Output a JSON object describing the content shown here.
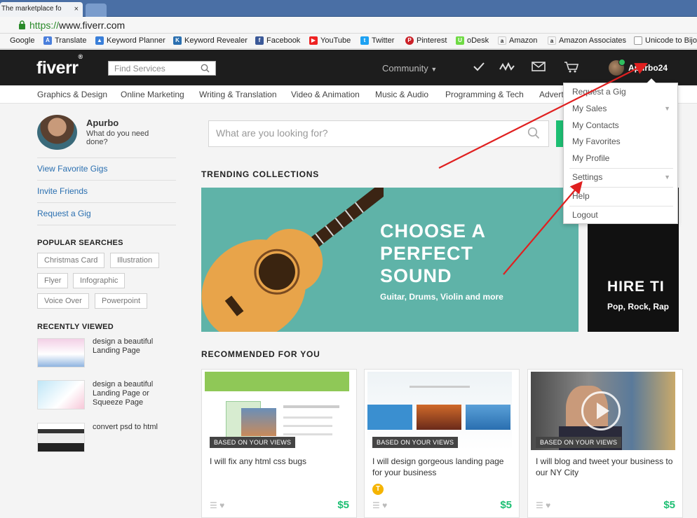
{
  "browser": {
    "tab_title": "The marketplace fo",
    "tab_close": "×",
    "url_scheme": "https://",
    "url_host": "www.fiverr.com",
    "bookmarks": [
      {
        "label": "Google",
        "icon": "google-icon"
      },
      {
        "label": "Translate",
        "icon": "translate-icon"
      },
      {
        "label": "Keyword Planner",
        "icon": "adwords-icon"
      },
      {
        "label": "Keyword Revealer",
        "icon": "keyword-revealer-icon"
      },
      {
        "label": "Facebook",
        "icon": "facebook-icon"
      },
      {
        "label": "YouTube",
        "icon": "youtube-icon"
      },
      {
        "label": "Twitter",
        "icon": "twitter-icon"
      },
      {
        "label": "Pinterest",
        "icon": "pinterest-icon"
      },
      {
        "label": "oDesk",
        "icon": "odesk-icon"
      },
      {
        "label": "Amazon",
        "icon": "amazon-icon"
      },
      {
        "label": "Amazon Associates",
        "icon": "amazon-icon"
      },
      {
        "label": "Unicode to Bijo",
        "icon": "page-icon"
      }
    ]
  },
  "header": {
    "logo": "fiverr",
    "logo_mark": "®",
    "search_placeholder": "Find Services",
    "community_label": "Community",
    "username": "Apurbo24"
  },
  "categories": [
    "Graphics & Design",
    "Online Marketing",
    "Writing & Translation",
    "Video & Animation",
    "Music & Audio",
    "Programming & Tech",
    "Advert"
  ],
  "sidebar": {
    "name": "Apurbo",
    "question": "What do you need done?",
    "links": [
      "View Favorite Gigs",
      "Invite Friends",
      "Request a Gig"
    ],
    "popular_title": "POPULAR SEARCHES",
    "popular": [
      "Christmas Card",
      "Illustration",
      "Flyer",
      "Infographic",
      "Voice Over",
      "Powerpoint"
    ],
    "recent_title": "RECENTLY VIEWED",
    "recent": [
      "design a beautiful Landing Page",
      "design a beautiful Landing Page or Squeeze Page",
      "convert psd to html"
    ]
  },
  "main": {
    "search_placeholder": "What are you looking for?",
    "trending_title": "TRENDING COLLECTIONS",
    "banner1_line1": "CHOOSE A",
    "banner1_line2": "PERFECT",
    "banner1_line3": "SOUND",
    "banner1_sub": "Guitar, Drums, Violin and more",
    "banner2_title": "HIRE TI",
    "banner2_sub": "Pop, Rock, Rap",
    "recommended_title": "RECOMMENDED FOR YOU",
    "cards": [
      {
        "badge": "BASED ON YOUR VIEWS",
        "title": "I will fix any html css bugs",
        "price": "$5"
      },
      {
        "badge": "BASED ON YOUR VIEWS",
        "title": "I will design gorgeous landing page for your business",
        "price": "$5",
        "level": "T"
      },
      {
        "badge": "BASED ON YOUR VIEWS",
        "title": "I will blog and tweet your business to our NY City",
        "price": "$5"
      }
    ]
  },
  "dropdown": {
    "items": [
      "Request a Gig",
      "My Sales",
      "My Contacts",
      "My Favorites",
      "My Profile",
      "Settings",
      "Help",
      "Logout"
    ]
  },
  "colors": {
    "brand_green": "#1dbf73",
    "header_bg": "#1d1d1d",
    "link_blue": "#2a6fb0",
    "annotation_red": "#e02020"
  }
}
